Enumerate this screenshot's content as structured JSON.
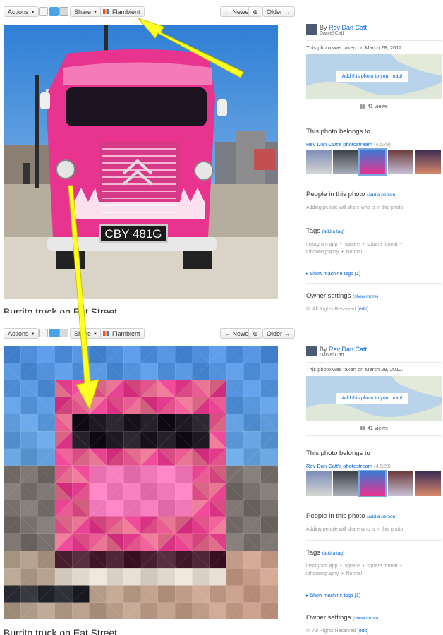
{
  "toolbar": {
    "actions_label": "Actions",
    "share_label": "Share",
    "flambient_label": "Flambient",
    "newer_label": "← Newer",
    "older_label": "Older →",
    "zoom_icon": "magnifier-icon",
    "share_icons": [
      "email-icon",
      "twitter-icon",
      "tumblr-icon"
    ]
  },
  "photo": {
    "caption": "Burrito truck on Eat Street",
    "plate": "CBY 481G"
  },
  "sidebar": {
    "by_label": "By",
    "author_name": "Rev Dan Catt",
    "author_realname": "Daniel Catt",
    "taken_text": "This photo was taken on March 28, 2012.",
    "map_button": "Add this photo to your map!",
    "views": "41 views",
    "belongs_heading": "This photo belongs to",
    "photostream_link": "Rev Dan Catt's photostream",
    "photostream_count": "(4,529)",
    "people_heading": "People in this photo",
    "add_person": "(add a person)",
    "people_hint": "Adding people will share who is in this photo",
    "tags_heading": "Tags",
    "add_tag": "(add a tag)",
    "tags_line1": [
      "instagram app",
      "square",
      "square format"
    ],
    "tags_line2": [
      "iphoneography",
      "Normal"
    ],
    "machine_tags": "Show machine tags (1)",
    "owner_heading": "Owner settings",
    "show_more": "(show more)",
    "rights_symbol": "©",
    "rights": "All Rights Reserved",
    "rights_edit": "(edit)"
  },
  "colors": {
    "link_blue": "#0063dc",
    "truck_pink": "#e8338f",
    "arrow_yellow": "#ffff22",
    "sky_blue": "#4f9ae0"
  }
}
